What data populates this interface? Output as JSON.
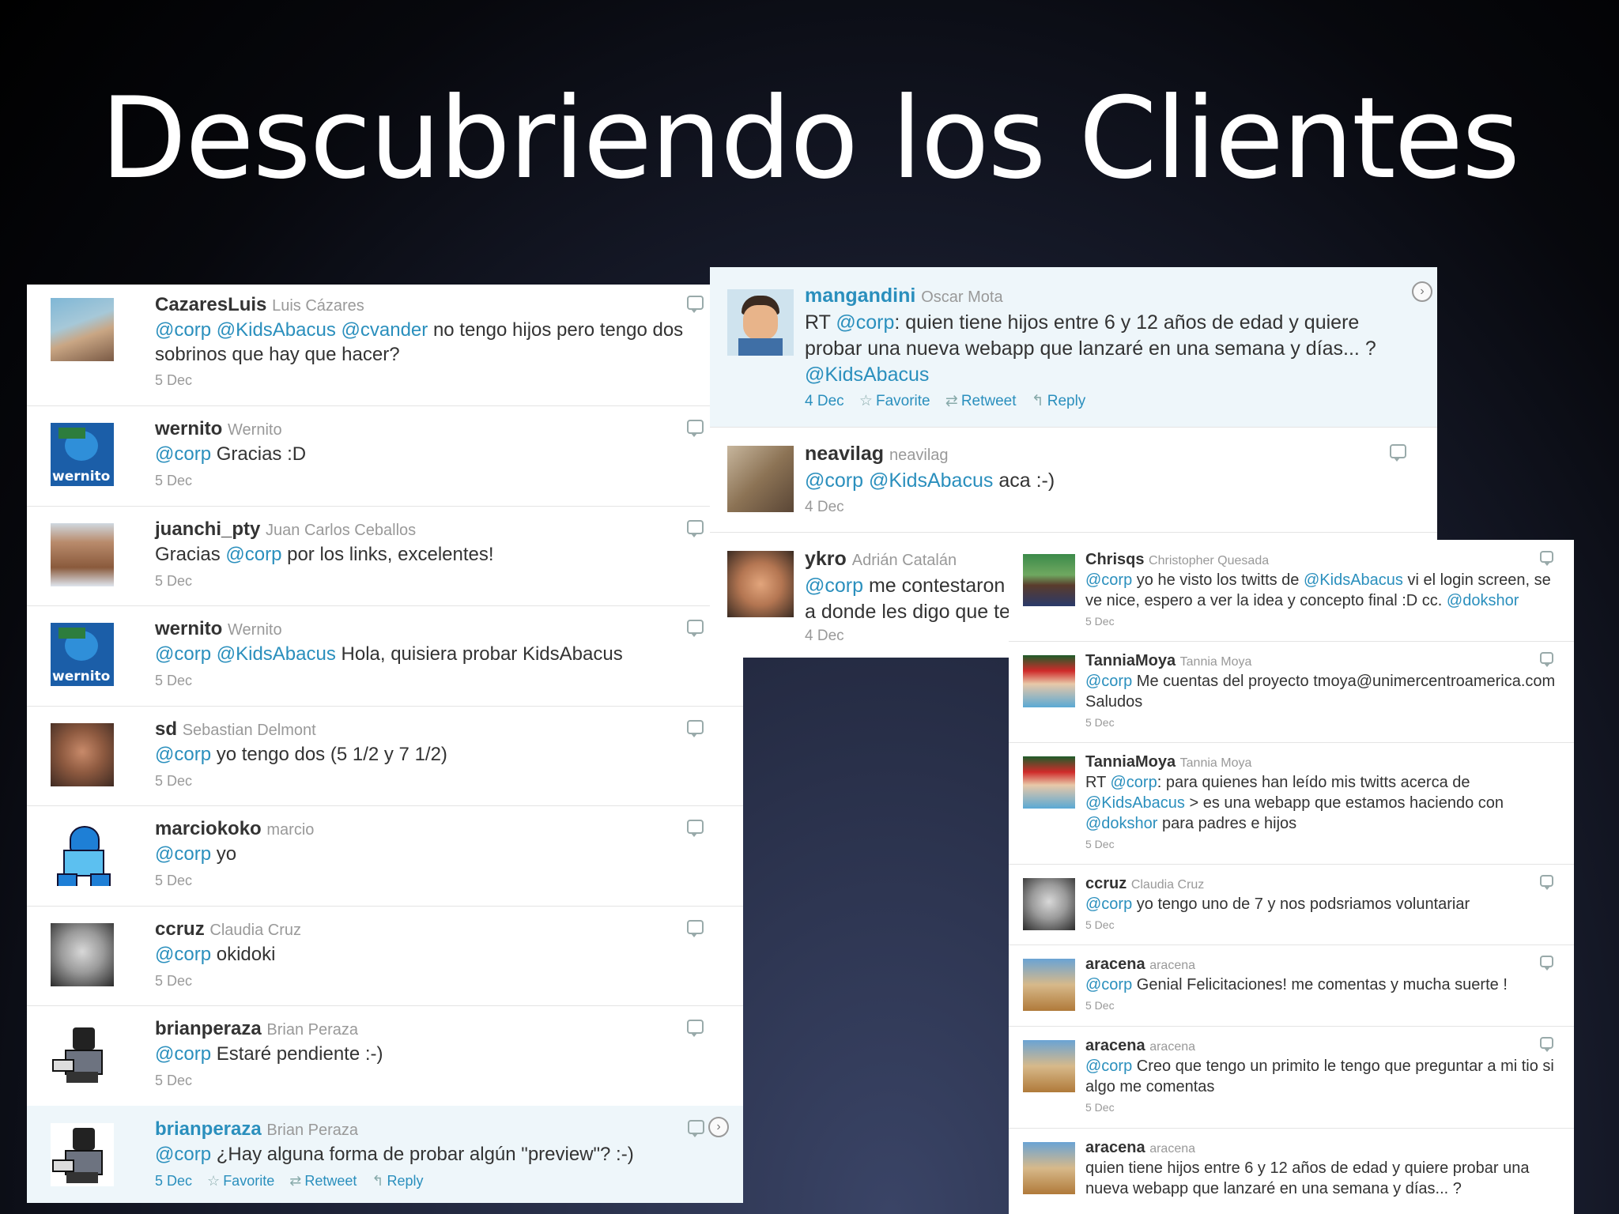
{
  "slide": {
    "title": "Descubriendo los Clientes"
  },
  "panel_a": {
    "tweets": [
      {
        "user": "CazaresLuis",
        "fullname": "Luis Cázares",
        "m1": "@corp",
        "m2": "@KidsAbacus",
        "m3": "@cvander",
        "text": "no tengo hijos pero tengo dos sobrinos que hay que hacer?",
        "date": "5 Dec"
      },
      {
        "user": "wernito",
        "fullname": "Wernito",
        "m1": "@corp",
        "text": "Gracias :D",
        "date": "5 Dec"
      },
      {
        "user": "juanchi_pty",
        "fullname": "Juan Carlos Ceballos",
        "pre": "Gracias",
        "m1": "@corp",
        "text": "por los links, excelentes!",
        "date": "5 Dec"
      },
      {
        "user": "wernito",
        "fullname": "Wernito",
        "m1": "@corp",
        "m2": "@KidsAbacus",
        "text": "Hola, quisiera probar KidsAbacus",
        "date": "5 Dec"
      },
      {
        "user": "sd",
        "fullname": "Sebastian Delmont",
        "m1": "@corp",
        "text": "yo tengo dos (5 1/2 y 7 1/2)",
        "date": "5 Dec"
      },
      {
        "user": "marciokoko",
        "fullname": "marcio",
        "m1": "@corp",
        "text": "yo",
        "date": "5 Dec"
      },
      {
        "user": "ccruz",
        "fullname": "Claudia Cruz",
        "m1": "@corp",
        "text": "okidoki",
        "date": "5 Dec"
      },
      {
        "user": "brianperaza",
        "fullname": "Brian Peraza",
        "m1": "@corp",
        "text": "Estaré pendiente :-)",
        "date": "5 Dec"
      },
      {
        "user": "brianperaza",
        "fullname": "Brian Peraza",
        "m1": "@corp",
        "text": "¿Hay alguna forma de probar algún \"preview\"? :-)",
        "date": "5 Dec",
        "favorite": "Favorite",
        "retweet": "Retweet",
        "reply": "Reply"
      }
    ]
  },
  "panel_b": {
    "tweets": [
      {
        "user": "mangandini",
        "fullname": "Oscar Mota",
        "rt": "RT",
        "m1": "@corp",
        "text": ": quien tiene hijos entre 6 y 12 años de edad y quiere probar una nueva webapp que lanzaré en una semana y días... ?",
        "m2": "@KidsAbacus",
        "date": "4 Dec",
        "favorite": "Favorite",
        "retweet": "Retweet",
        "reply": "Reply"
      },
      {
        "user": "neavilag",
        "fullname": "neavilag",
        "m1": "@corp",
        "m2": "@KidsAbacus",
        "text": "aca :-)",
        "date": "4 Dec"
      },
      {
        "user": "ykro",
        "fullname": "Adrián Catalán",
        "m1": "@corp",
        "text": "me contestaron a donde les digo que te",
        "date": "4 Dec"
      }
    ]
  },
  "panel_c": {
    "tweets": [
      {
        "user": "Chrisqs",
        "fullname": "Christopher Quesada",
        "m1": "@corp",
        "t1": "yo he visto los twitts de",
        "m2": "@KidsAbacus",
        "t2": "vi el login screen, se ve nice, espero a ver la idea y concepto final :D cc.",
        "m3": "@dokshor",
        "date": "5 Dec"
      },
      {
        "user": "TanniaMoya",
        "fullname": "Tannia Moya",
        "m1": "@corp",
        "t1": "Me cuentas del proyecto tmoya@unimercentroamerica.com Saludos",
        "date": "5 Dec"
      },
      {
        "user": "TanniaMoya",
        "fullname": "Tannia Moya",
        "rt": "RT",
        "m1": "@corp",
        "t1": ": para quienes han leído mis twitts acerca de",
        "m2": "@KidsAbacus",
        "t2": "> es una webapp que estamos haciendo con",
        "m3": "@dokshor",
        "t3": "para padres e hijos",
        "date": "5 Dec"
      },
      {
        "user": "ccruz",
        "fullname": "Claudia Cruz",
        "m1": "@corp",
        "t1": "yo tengo uno de 7 y nos podsriamos voluntariar",
        "date": "5 Dec"
      },
      {
        "user": "aracena",
        "fullname": "aracena",
        "m1": "@corp",
        "t1": "Genial Felicitaciones! me comentas y mucha suerte !",
        "date": "5 Dec"
      },
      {
        "user": "aracena",
        "fullname": "aracena",
        "m1": "@corp",
        "t1": "Creo que tengo un primito le tengo que preguntar a mi tio si algo me comentas",
        "date": "5 Dec"
      },
      {
        "user": "aracena",
        "fullname": "aracena",
        "t1": "quien tiene hijos entre 6 y 12 años de edad y quiere probar una nueva webapp que lanzaré en una semana y días... ?"
      }
    ]
  },
  "icons": {
    "favorite": "star-icon",
    "retweet": "retweet-icon",
    "reply": "reply-icon",
    "bubble": "reply-bubble-icon",
    "expand": "chevron-right-icon"
  },
  "colors": {
    "link": "#2a8fbd",
    "highlight": "#eef6fa",
    "name": "#333333",
    "meta": "#999999"
  }
}
